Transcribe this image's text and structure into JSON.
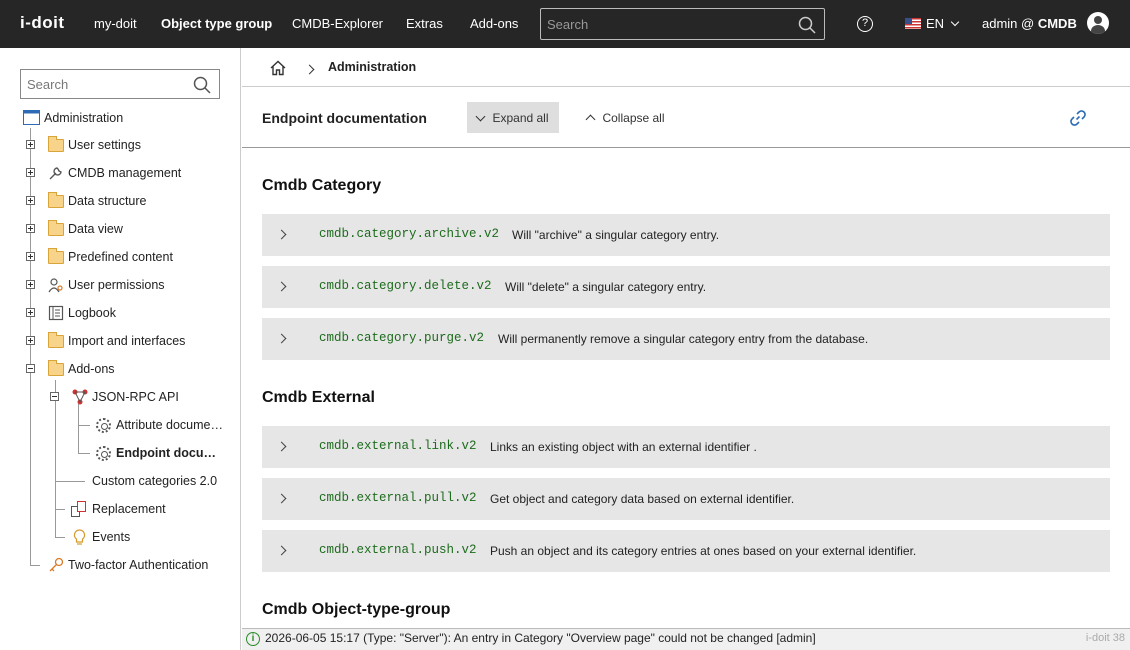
{
  "topbar": {
    "logo": "i-doit",
    "nav": [
      "my-doit",
      "Object type group",
      "CMDB-Explorer",
      "Extras",
      "Add-ons"
    ],
    "search_placeholder": "Search",
    "help": "?",
    "language": "EN",
    "user_prefix": "admin @",
    "user_db": "CMDB"
  },
  "sidebar": {
    "search_placeholder": "Search",
    "root": "Administration",
    "items": [
      "User settings",
      "CMDB management",
      "Data structure",
      "Data view",
      "Predefined content",
      "User permissions",
      "Logbook",
      "Import and interfaces",
      "Add-ons",
      "JSON-RPC API",
      "Attribute docume…",
      "Endpoint docu…",
      "Custom categories 2.0",
      "Replacement",
      "Events",
      "Two-factor Authentication"
    ]
  },
  "breadcrumb": {
    "current": "Administration"
  },
  "toolbar": {
    "title": "Endpoint documentation",
    "expand_label": "Expand all",
    "collapse_label": "Collapse all"
  },
  "sections": [
    {
      "title": "Cmdb Category",
      "endpoints": [
        {
          "code": "cmdb.category.archive.v2",
          "desc": "Will \"archive\" a singular category entry."
        },
        {
          "code": "cmdb.category.delete.v2",
          "desc": "Will \"delete\" a singular category entry."
        },
        {
          "code": "cmdb.category.purge.v2",
          "desc": "Will permanently remove a singular category entry from the database."
        }
      ]
    },
    {
      "title": "Cmdb External",
      "endpoints": [
        {
          "code": "cmdb.external.link.v2",
          "desc": "Links an existing object with an external identifier ."
        },
        {
          "code": "cmdb.external.pull.v2",
          "desc": "Get object and category data based on external identifier."
        },
        {
          "code": "cmdb.external.push.v2",
          "desc": "Push an object and its category entries at ones based on your external identifier."
        }
      ]
    },
    {
      "title": "Cmdb Object-type-group",
      "endpoints": []
    }
  ],
  "status": {
    "icon": "i",
    "message": "2026-06-05 15:17 (Type: \"Server\"): An entry in Category \"Overview page\" could not be changed [admin]",
    "version": "i-doit 38"
  },
  "colors": {
    "topbar": "#262626",
    "endpoint_bg": "#e6e6e6",
    "code_green": "#1d6b1d"
  }
}
